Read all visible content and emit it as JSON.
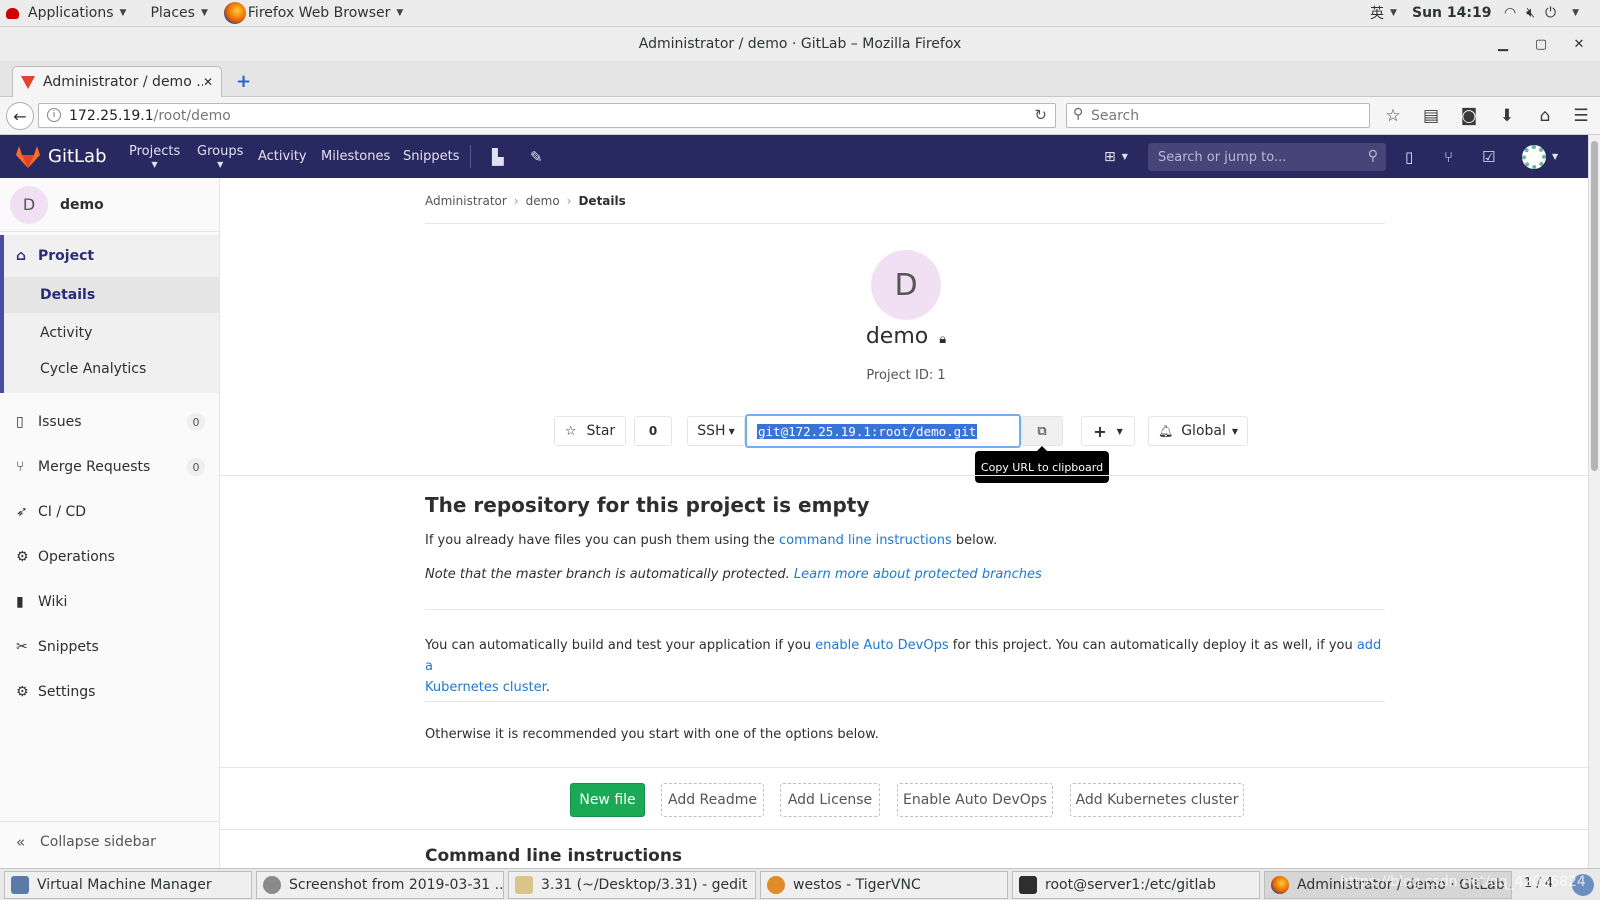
{
  "os_topbar": {
    "applications": "Applications",
    "places": "Places",
    "active_app": "Firefox Web Browser",
    "input_method": "英",
    "clock": "Sun 14:19"
  },
  "window": {
    "title": "Administrator / demo · GitLab – Mozilla Firefox"
  },
  "browser": {
    "tab_title": "Administrator / demo ...",
    "url_host": "172.25.19.1",
    "url_path": "/root/demo",
    "search_placeholder": "Search"
  },
  "gitlab_header": {
    "logo_text": "GitLab",
    "nav": [
      "Projects",
      "Groups",
      "Activity",
      "Milestones",
      "Snippets"
    ],
    "search_placeholder": "Search or jump to..."
  },
  "sidebar": {
    "project_letter": "D",
    "project_name": "demo",
    "section": "Project",
    "sub_items": [
      "Details",
      "Activity",
      "Cycle Analytics"
    ],
    "items": [
      {
        "label": "Issues",
        "count": "0"
      },
      {
        "label": "Merge Requests",
        "count": "0"
      },
      {
        "label": "CI / CD"
      },
      {
        "label": "Operations"
      },
      {
        "label": "Wiki"
      },
      {
        "label": "Snippets"
      },
      {
        "label": "Settings"
      }
    ],
    "collapse": "Collapse sidebar"
  },
  "breadcrumb": [
    "Administrator",
    "demo",
    "Details"
  ],
  "project": {
    "avatar_letter": "D",
    "name": "demo",
    "id_text": "Project ID: 1",
    "star_label": "Star",
    "star_count": "0",
    "protocol": "SSH",
    "clone_url": "git@172.25.19.1:root/demo.git",
    "tooltip": "Copy URL to clipboard",
    "notification": "Global"
  },
  "empty_repo": {
    "heading": "The repository for this project is empty",
    "p1_before": "If you already have files you can push them using the ",
    "p1_link": "command line instructions",
    "p1_after": " below.",
    "note_text": "Note that the master branch is automatically protected. ",
    "note_link": "Learn more about protected branches",
    "p2_before": "You can automatically build and test your application if you ",
    "p2_link1": "enable Auto DevOps",
    "p2_middle": " for this project. You can automatically deploy it as well, if you ",
    "p2_link2a": "add a",
    "p2_link2b": "Kubernetes cluster",
    "p2_after": ".",
    "p3": "Otherwise it is recommended you start with one of the options below."
  },
  "actions": {
    "new_file": "New file",
    "add_readme": "Add Readme",
    "add_license": "Add License",
    "enable_auto_devops": "Enable Auto DevOps",
    "add_kubernetes": "Add Kubernetes cluster"
  },
  "cli_heading": "Command line instructions",
  "taskbar": {
    "items": [
      "Virtual Machine Manager",
      "Screenshot from 2019-03-31 ...",
      "3.31 (~/Desktop/3.31) - gedit",
      "westos - TigerVNC",
      "root@server1:/etc/gitlab",
      "Administrator / demo · GitLab ..."
    ],
    "pager": "1 / 4",
    "watermark": "https://blog.csdn.net/qq_42036824"
  },
  "colors": {
    "gitlab_header": "#292961",
    "link": "#1f78d1",
    "new_file_button": "#1aaa55",
    "sidebar_active_border": "#4b4ba3"
  }
}
